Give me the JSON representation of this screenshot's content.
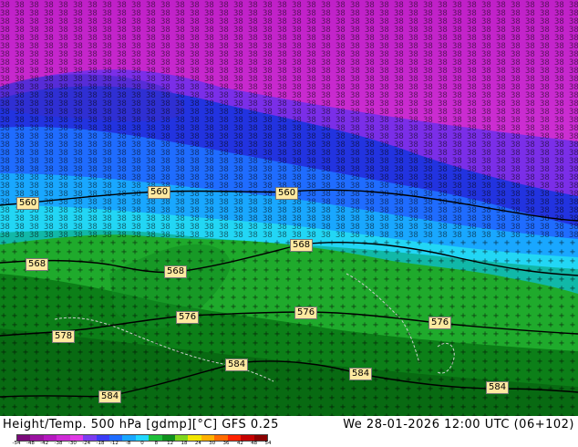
{
  "map": {
    "contour_labels": [
      "560",
      "560",
      "560",
      "568",
      "568",
      "568",
      "576",
      "576",
      "576",
      "578",
      "584",
      "584",
      "584",
      "584"
    ]
  },
  "footer": {
    "title_left": "Height/Temp. 500 hPa [gdmp][°C] GFS 0.25",
    "title_right": "We 28-01-2026 12:00 UTC (06+102)"
  },
  "colorbar": {
    "ticks": [
      "-54",
      "-48",
      "-42",
      "-38",
      "-30",
      "-24",
      "-18",
      "-12",
      "-8",
      "0",
      "8",
      "12",
      "18",
      "24",
      "30",
      "36",
      "42",
      "48",
      "54"
    ],
    "colors": [
      "#7a0a7a",
      "#9a12a0",
      "#b518bf",
      "#cf2ad6",
      "#e03ae6",
      "#7b3cf0",
      "#3b3bf5",
      "#1f6cff",
      "#19a7ff",
      "#22d6ff",
      "#1fbf3a",
      "#0e8f1c",
      "#7fd61c",
      "#f2e600",
      "#ffb000",
      "#ff6a00",
      "#ff2200",
      "#c40000",
      "#8a0000"
    ]
  }
}
